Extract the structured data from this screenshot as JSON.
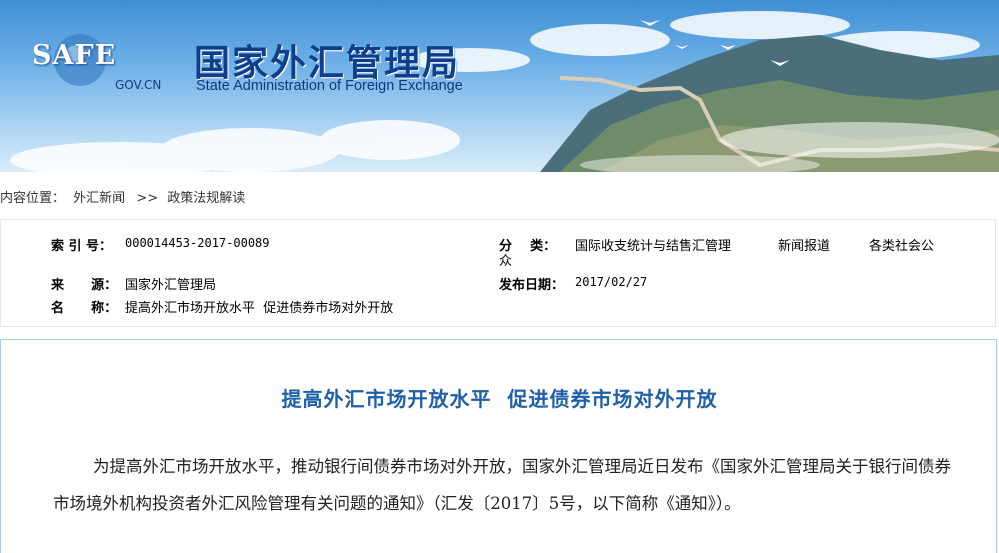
{
  "banner": {
    "logo_text": "SAFE",
    "logo_domain": "GOV.CN",
    "title_cn": "国家外汇管理局",
    "title_en": "State Administration of Foreign Exchange"
  },
  "breadcrumb": {
    "prefix": "内容位置：",
    "items": [
      "外汇新闻",
      "政策法规解读"
    ],
    "separator": ">>"
  },
  "meta": {
    "index_label": "索 引 号：",
    "index_value": "000014453-2017-00089",
    "category_label": "分    类：",
    "category_wrap": "众",
    "category_values": [
      "国际收支统计与结售汇管理",
      "新闻报道",
      "各类社会公"
    ],
    "source_label": "来      源：",
    "source_value": "国家外汇管理局",
    "date_label": "发布日期：",
    "date_value": "2017/02/27",
    "name_label": "名      称：",
    "name_value": "提高外汇市场开放水平  促进债券市场对外开放"
  },
  "article": {
    "title": "提高外汇市场开放水平  促进债券市场对外开放",
    "paragraph": "为提高外汇市场开放水平，推动银行间债券市场对外开放，国家外汇管理局近日发布《国家外汇管理局关于银行间债券市场境外机构投资者外汇风险管理有关问题的通知》（汇发〔2017〕5号，以下简称《通知》）。"
  },
  "colors": {
    "title_blue": "#1f5fa8",
    "banner_title": "#0d3f8c",
    "article_border": "#a9c9e6"
  }
}
